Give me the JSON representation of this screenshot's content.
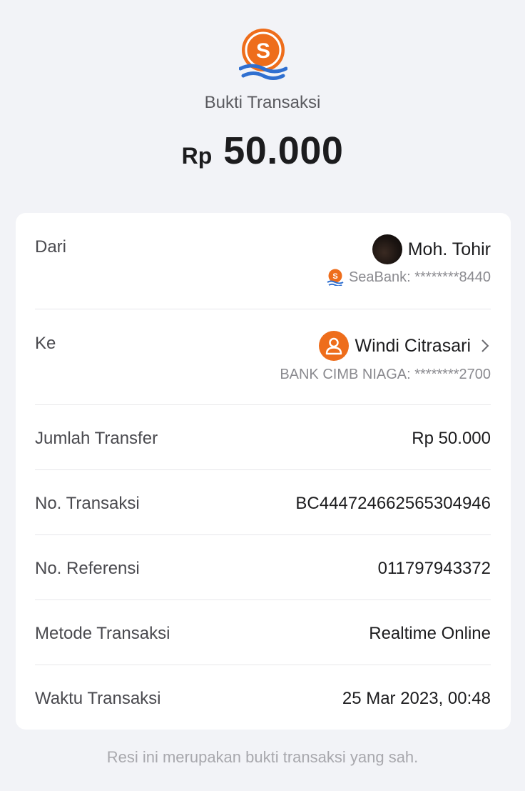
{
  "header": {
    "logo_icon": "seabank-logo-icon",
    "title": "Bukti Transaksi",
    "currency": "Rp",
    "amount": "50.000"
  },
  "details": {
    "from": {
      "label": "Dari",
      "name": "Moh. Tohir",
      "account": "SeaBank: ********8440"
    },
    "to": {
      "label": "Ke",
      "name": "Windi Citrasari",
      "account": "BANK CIMB NIAGA: ********2700"
    },
    "rows": [
      {
        "label": "Jumlah Transfer",
        "value": "Rp 50.000"
      },
      {
        "label": "No. Transaksi",
        "value": "BC444724662565304946"
      },
      {
        "label": "No. Referensi",
        "value": "011797943372"
      },
      {
        "label": "Metode Transaksi",
        "value": "Realtime Online"
      },
      {
        "label": "Waktu Transaksi",
        "value": "25 Mar 2023, 00:48"
      }
    ]
  },
  "footer": {
    "note": "Resi ini merupakan bukti transaksi yang sah."
  },
  "colors": {
    "brand_orange": "#ee6d1b",
    "brand_blue": "#2f6fd0",
    "background": "#f2f3f7"
  }
}
